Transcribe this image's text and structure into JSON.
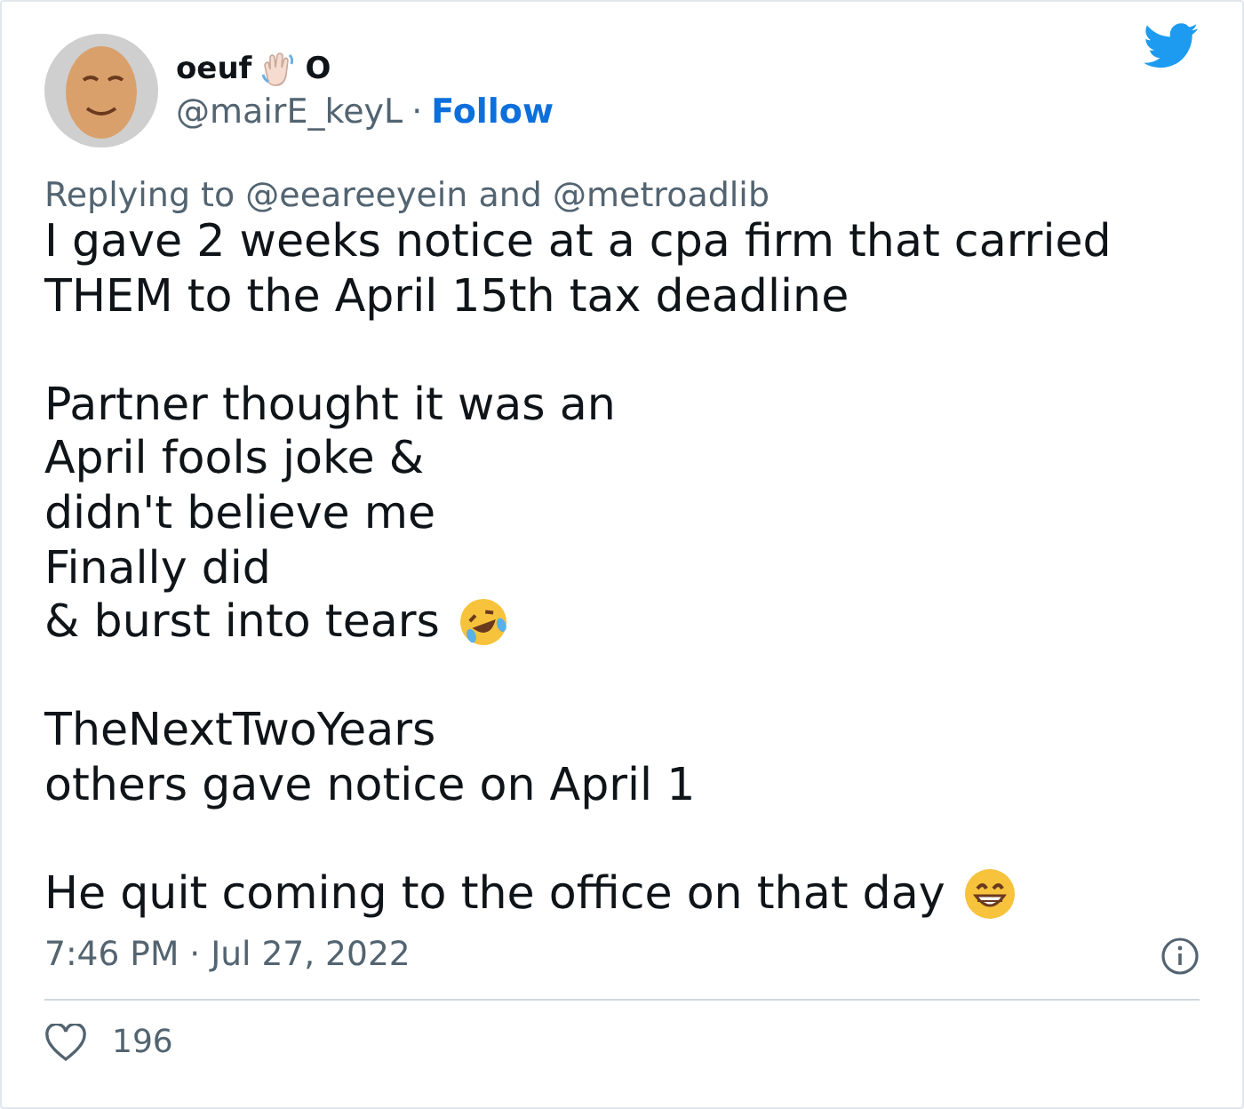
{
  "author": {
    "name": "oeuf",
    "name_suffix": "O",
    "handle": "@mairE_keyL",
    "separator": "·",
    "follow": "Follow"
  },
  "reply_to": "Replying to @eeareeyein and @metroadlib",
  "body": [
    {
      "lines": [
        {
          "text": "I gave 2 weeks notice at a cpa firm that carried"
        },
        {
          "text": "THEM to the April 15th tax deadline"
        }
      ]
    },
    {
      "lines": [
        {
          "text": "Partner thought it was an"
        },
        {
          "text": "April fools joke &"
        },
        {
          "text": "didn't believe me"
        },
        {
          "text": "Finally did"
        },
        {
          "text": "& burst into tears",
          "kind": "with-laugh"
        }
      ]
    },
    {
      "lines": [
        {
          "text": "TheNextTwoYears"
        },
        {
          "text": "others gave notice on April 1"
        }
      ]
    },
    {
      "lines": [
        {
          "text": "He quit coming to the office on that day",
          "kind": "with-grin"
        }
      ]
    }
  ],
  "timestamp": "7:46 PM · Jul 27, 2022",
  "likes": "196"
}
